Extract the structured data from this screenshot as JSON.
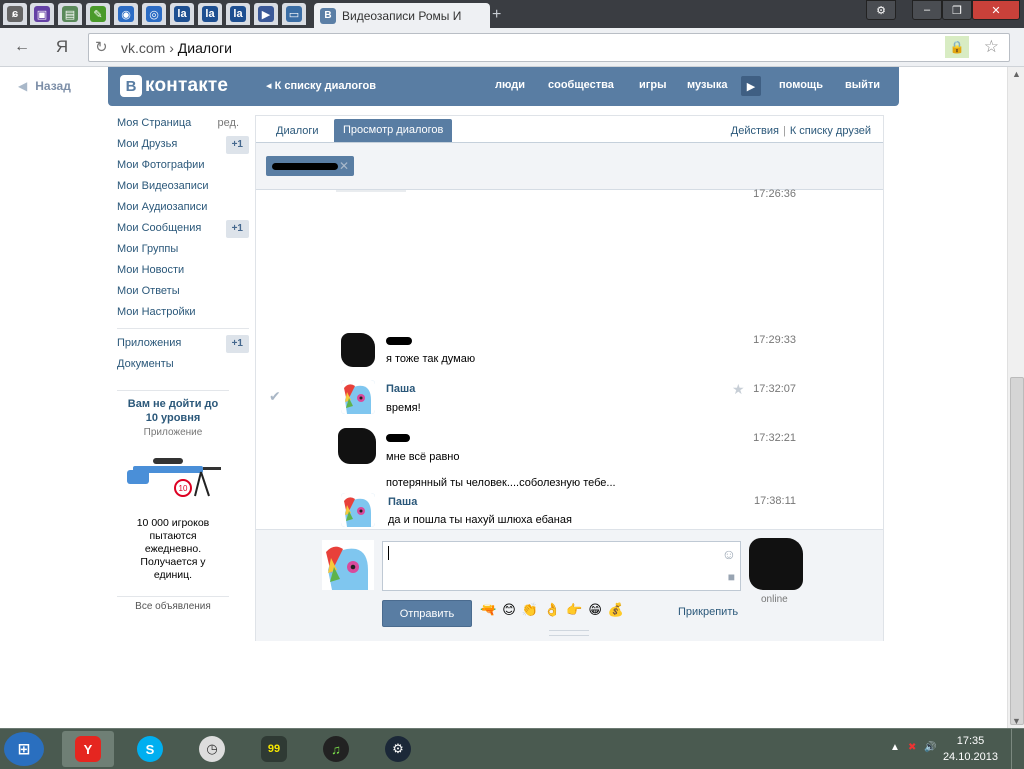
{
  "browser": {
    "tab_title": "Видеозаписи Ромы И",
    "url_domain": "vk.com",
    "url_sep": "›",
    "url_page": "Диалоги",
    "back_glyph": "←",
    "yandex_glyph": "Я"
  },
  "vk": {
    "back_label": "Назад",
    "logo_letter": "В",
    "logo_text": "контакте",
    "to_dialogs": "К списку диалогов",
    "nav": [
      "люди",
      "сообщества",
      "игры",
      "музыка",
      "помощь",
      "выйти"
    ]
  },
  "sidebar": {
    "edit_label": "ред.",
    "items": [
      {
        "label": "Моя Страница"
      },
      {
        "label": "Мои Друзья",
        "count": "+1"
      },
      {
        "label": "Мои Фотографии"
      },
      {
        "label": "Мои Видеозаписи"
      },
      {
        "label": "Мои Аудиозаписи"
      },
      {
        "label": "Мои Сообщения",
        "count": "+1"
      },
      {
        "label": "Мои Группы"
      },
      {
        "label": "Мои Новости"
      },
      {
        "label": "Мои Ответы"
      },
      {
        "label": "Мои Настройки"
      }
    ],
    "items2": [
      {
        "label": "Приложения",
        "count": "+1"
      },
      {
        "label": "Документы"
      }
    ]
  },
  "ad": {
    "title_line1": "Вам не дойти до",
    "title_line2": "10 уровня",
    "subtitle": "Приложение",
    "badge": "10",
    "text_lines": [
      "10 000 игроков",
      "пытаются",
      "ежедневно.",
      "Получается у",
      "единиц."
    ],
    "all_ads": "Все объявления"
  },
  "dialog": {
    "tab_dialogs": "Диалоги",
    "tab_view": "Просмотр диалогов",
    "actions": "Действия",
    "friends_list": "К списку друзей",
    "top_time": "17:26:36",
    "messages": [
      {
        "author": "",
        "text": "я тоже так думаю",
        "time": "17:29:33"
      },
      {
        "author": "Паша",
        "text": "время!",
        "time": "17:32:07"
      },
      {
        "author": "",
        "text": "мне всё равно",
        "time": "17:32:21"
      },
      {
        "author": "",
        "text": "потерянный ты человек....соболезную тебе...",
        "time": ""
      },
      {
        "author": "Паша",
        "text": "да и пошла ты нахуй шлюха ебаная",
        "time": "17:38:11"
      }
    ]
  },
  "composer": {
    "send_label": "Отправить",
    "attach_label": "Прикрепить",
    "online_label": "online",
    "emoji": [
      "🔫",
      "😊",
      "👏",
      "👌",
      "👉",
      "😁",
      "💰"
    ]
  },
  "taskbar": {
    "time": "17:35",
    "date": "24.10.2013",
    "badge_99": "99"
  },
  "colors": {
    "vk_blue": "#597da3",
    "link": "#2b587a",
    "taskbar": "#4a5a50"
  }
}
